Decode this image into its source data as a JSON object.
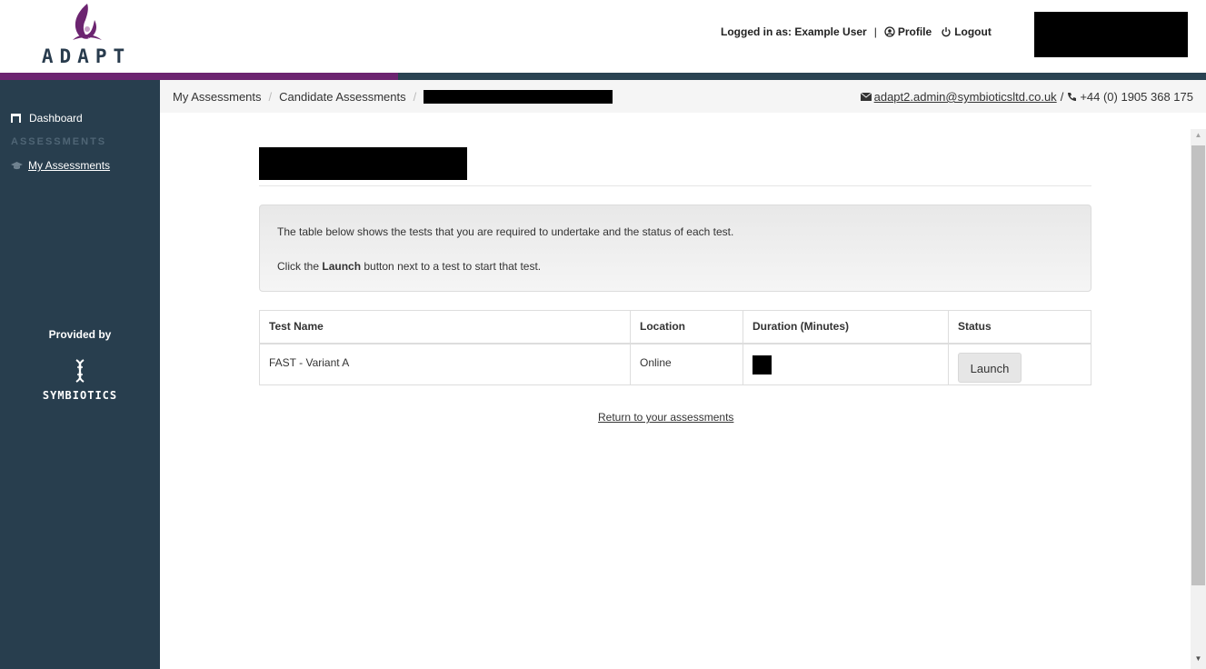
{
  "header": {
    "logo_text": "ADAPT",
    "logged_in_label": "Logged in as: Example User",
    "separator": "|",
    "profile_label": "Profile",
    "logout_label": "Logout"
  },
  "sidebar": {
    "dashboard_label": "Dashboard",
    "section_label": "ASSESSMENTS",
    "my_assessments_label": "My Assessments",
    "provided_by": "Provided by",
    "partner_logo_text": "SYMBIOTICS"
  },
  "breadcrumb": {
    "items": [
      "My Assessments",
      "Candidate Assessments"
    ],
    "separator": "/"
  },
  "contact": {
    "email": "adapt2.admin@symbioticsltd.co.uk",
    "separator": "/",
    "phone": "+44 (0) 1905 368 175"
  },
  "info": {
    "line1": "The table below shows the tests that you are required to undertake and the status of each test.",
    "line2_prefix": "Click the ",
    "line2_bold": "Launch",
    "line2_suffix": " button next to a test to start that test."
  },
  "table": {
    "headers": [
      "Test Name",
      "Location",
      "Duration (Minutes)",
      "Status"
    ],
    "rows": [
      {
        "test_name": "FAST - Variant A",
        "location": "Online",
        "action": "Launch"
      }
    ]
  },
  "return_link": "Return to your assessments",
  "colors": {
    "sidebar": "#283e4e",
    "accent_purple": "#6c2470",
    "accent_teal": "#2a4352"
  }
}
